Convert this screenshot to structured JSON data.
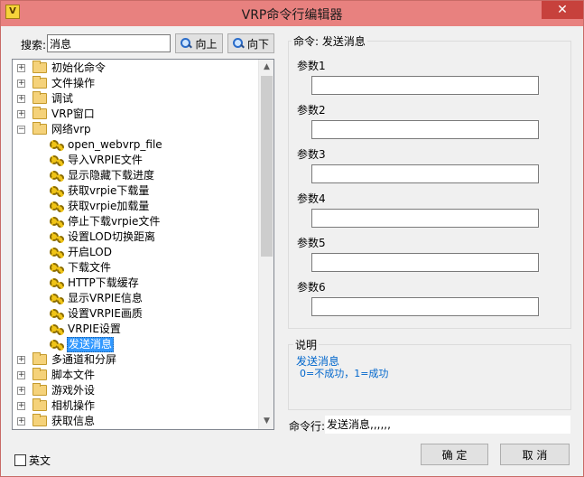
{
  "window": {
    "title": "VRP命令行编辑器",
    "close": "✕"
  },
  "search": {
    "label": "搜索:",
    "value": "消息",
    "up_label": "向上",
    "down_label": "向下"
  },
  "tree": {
    "items": [
      {
        "label": "初始化命令",
        "type": "folder",
        "state": "collapsed"
      },
      {
        "label": "文件操作",
        "type": "folder",
        "state": "collapsed"
      },
      {
        "label": "调试",
        "type": "folder",
        "state": "collapsed"
      },
      {
        "label": "VRP窗口",
        "type": "folder",
        "state": "collapsed"
      },
      {
        "label": "网络vrp",
        "type": "folder",
        "state": "expanded"
      },
      {
        "label": "open_webvrp_file",
        "type": "command"
      },
      {
        "label": "导入VRPIE文件",
        "type": "command"
      },
      {
        "label": "显示隐藏下载进度",
        "type": "command"
      },
      {
        "label": "获取vrpie下载量",
        "type": "command"
      },
      {
        "label": "获取vrpie加载量",
        "type": "command"
      },
      {
        "label": "停止下载vrpie文件",
        "type": "command"
      },
      {
        "label": "设置LOD切换距离",
        "type": "command"
      },
      {
        "label": "开启LOD",
        "type": "command"
      },
      {
        "label": "下载文件",
        "type": "command"
      },
      {
        "label": "HTTP下载缓存",
        "type": "command"
      },
      {
        "label": "显示VRPIE信息",
        "type": "command"
      },
      {
        "label": "设置VRPIE画质",
        "type": "command"
      },
      {
        "label": "VRPIE设置",
        "type": "command"
      },
      {
        "label": "发送消息",
        "type": "command",
        "selected": true
      },
      {
        "label": "多通道和分屏",
        "type": "folder",
        "state": "collapsed"
      },
      {
        "label": "脚本文件",
        "type": "folder",
        "state": "collapsed"
      },
      {
        "label": "游戏外设",
        "type": "folder",
        "state": "collapsed"
      },
      {
        "label": "相机操作",
        "type": "folder",
        "state": "collapsed"
      },
      {
        "label": "获取信息",
        "type": "folder",
        "state": "collapsed"
      }
    ]
  },
  "english": {
    "label": "英文",
    "checked": false
  },
  "command": {
    "title": "命令: 发送消息",
    "params": [
      {
        "label": "参数1",
        "value": ""
      },
      {
        "label": "参数2",
        "value": ""
      },
      {
        "label": "参数3",
        "value": ""
      },
      {
        "label": "参数4",
        "value": ""
      },
      {
        "label": "参数5",
        "value": ""
      },
      {
        "label": "参数6",
        "value": ""
      }
    ]
  },
  "description": {
    "title": "说明",
    "line1": "发送消息",
    "line2": "0=不成功，1=成功"
  },
  "command_line": {
    "label": "命令行:",
    "value": "发送消息,,,,,,"
  },
  "buttons": {
    "ok": "确 定",
    "cancel": "取 消"
  },
  "colors": {
    "titlebar": "#e8817f",
    "close": "#c7413c",
    "selection": "#3399ff",
    "description_text": "#0066cc"
  }
}
